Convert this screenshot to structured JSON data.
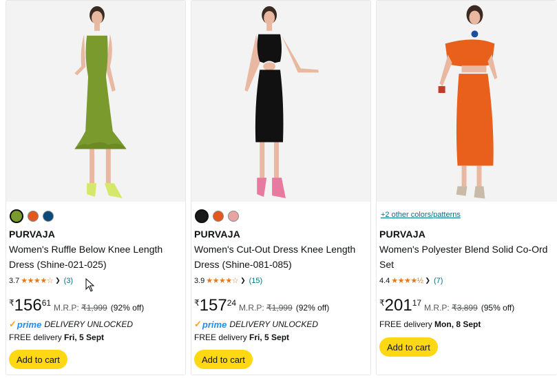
{
  "products": [
    {
      "swatches": [
        "#7a9a2e",
        "#e2581f",
        "#0c4a7a"
      ],
      "brand": "PURVAJA",
      "title": "Women's Ruffle Below Knee Length Dress (Shine-021-025)",
      "rating": "3.7",
      "stars": "★★★★☆",
      "reviews": "(3)",
      "currency": "₹",
      "price_whole": "156",
      "price_fraction": "61",
      "mrp_label": "M.R.P:",
      "mrp": "₹1,999",
      "discount": "(92% off)",
      "prime_word": "prime",
      "prime_text": "DELIVERY UNLOCKED",
      "delivery_prefix": "FREE delivery",
      "delivery_date": "Fri, 5 Sept",
      "button": "Add to cart"
    },
    {
      "swatches": [
        "#1a1a1a",
        "#e2581f",
        "#e8a3a3"
      ],
      "brand": "PURVAJA",
      "title": "Women's Cut-Out Dress Knee Length Dress (Shine-081-085)",
      "rating": "3.9",
      "stars": "★★★★☆",
      "reviews": "(15)",
      "currency": "₹",
      "price_whole": "157",
      "price_fraction": "24",
      "mrp_label": "M.R.P:",
      "mrp": "₹1,999",
      "discount": "(92% off)",
      "prime_word": "prime",
      "prime_text": "DELIVERY UNLOCKED",
      "delivery_prefix": "FREE delivery",
      "delivery_date": "Fri, 5 Sept",
      "button": "Add to cart"
    },
    {
      "more_colors": "+2 other colors/patterns",
      "brand": "PURVAJA",
      "title": "Women's Polyester Blend Solid Co-Ord Set",
      "rating": "4.4",
      "stars": "★★★★½",
      "reviews": "(7)",
      "currency": "₹",
      "price_whole": "201",
      "price_fraction": "17",
      "mrp_label": "M.R.P:",
      "mrp": "₹3,899",
      "discount": "(95% off)",
      "delivery_prefix": "FREE delivery",
      "delivery_date": "Mon, 8 Sept",
      "button": "Add to cart"
    }
  ],
  "colors": {
    "accent_link": "#007185",
    "button_bg": "#ffd814",
    "star": "#de7921",
    "prime_blue": "#1f8ef0"
  }
}
